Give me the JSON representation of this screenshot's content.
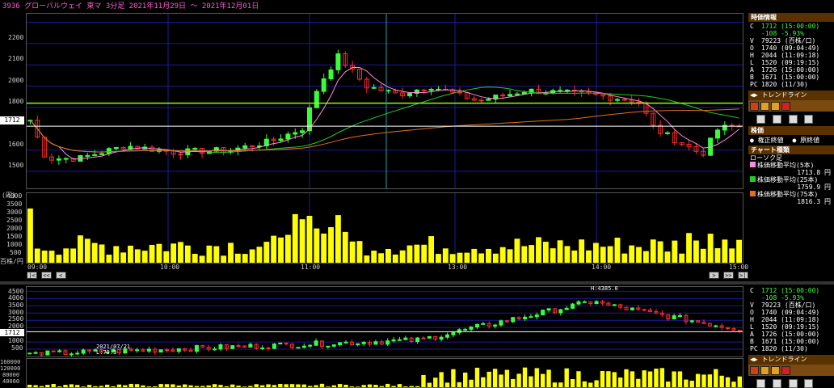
{
  "title": "3936 グローバルウェイ 東マ 3分足 2021年11月29日 ～ 2021年12月01日",
  "colors": {
    "up": "#39ff39",
    "down": "#ff2a2a",
    "ma5": "#ff8be0",
    "ma25": "#22cc22",
    "ma75": "#e07020",
    "volume": "#ffff00",
    "trend": "#8cff00",
    "price_line": "#ffffff",
    "panel_header": "#5a3200",
    "grid": "#1a1aa0"
  },
  "main_chart": {
    "y_ticks": [
      "2200",
      "2100",
      "2000",
      "1900",
      "1800",
      "1712",
      "1600",
      "1500"
    ],
    "current_price_label": "1712",
    "volume_unit": "(円)",
    "volume_ticks": [
      "4000",
      "3500",
      "3000",
      "2500",
      "2000",
      "1500",
      "1000",
      "500"
    ],
    "volume_unit_bottom": "百株/円",
    "time_labels": [
      "09:00",
      "10:00",
      "11:00",
      "13:00",
      "14:00",
      "15:00"
    ]
  },
  "nav_buttons": {
    "first": "|<",
    "prev_page": "<<",
    "prev": "<",
    "next": ">",
    "next_page": ">>",
    "last": ">|"
  },
  "bottom_chart": {
    "y_ticks": [
      "4500",
      "4000",
      "3500",
      "3000",
      "2500",
      "2000",
      "1712",
      "1000",
      "500"
    ],
    "high_annotation": "H:4385.0",
    "low_date": "2021/07/21",
    "low_annotation": "L:79.3",
    "volume_ticks": [
      "160000",
      "120000",
      "80000",
      "40000"
    ]
  },
  "panel": {
    "header": "時価情報",
    "rows": [
      {
        "k": "C",
        "v": "1712 (15:00:00)"
      },
      {
        "k": "",
        "v": "-108 -5.93%"
      },
      {
        "k": "V",
        "v": "79223 (百株/口)"
      },
      {
        "k": "O",
        "v": "1740 (09:04:49)"
      },
      {
        "k": "H",
        "v": "2044 (11:09:18)"
      },
      {
        "k": "L",
        "v": "1520 (09:19:15)"
      },
      {
        "k": "A",
        "v": "1726 (15:00:00)"
      },
      {
        "k": "B",
        "v": "1671 (15:00:00)"
      },
      {
        "k": "PC",
        "v": "1820 (11/30)"
      }
    ],
    "trendline_label": "トレンドライン",
    "stock_header": "株価",
    "radio_adjusted": "権正終値",
    "radio_original": "原終値",
    "chart_type_header": "チャート種類",
    "candle_label": "ローソク足",
    "ma": [
      {
        "label": "株価移動平均(5本)",
        "value": "1713.8 円"
      },
      {
        "label": "株価移動平均(25本)",
        "value": "1759.9 円"
      },
      {
        "label": "株価移動平均(75本)",
        "value": "1816.3 円"
      }
    ]
  },
  "panel2": {
    "rows": [
      {
        "k": "C",
        "v": "1712 (15:00:00)"
      },
      {
        "k": "",
        "v": "-108 -5.93%"
      },
      {
        "k": "V",
        "v": "79223 (百株/口)"
      },
      {
        "k": "O",
        "v": "1740 (09:04:49)"
      },
      {
        "k": "H",
        "v": "2044 (11:09:18)"
      },
      {
        "k": "L",
        "v": "1520 (09:19:15)"
      },
      {
        "k": "A",
        "v": "1726 (15:00:00)"
      },
      {
        "k": "B",
        "v": "1671 (15:00:00)"
      },
      {
        "k": "PC",
        "v": "1820 (11/30)"
      }
    ],
    "trendline_label": "トレンドライン"
  }
}
